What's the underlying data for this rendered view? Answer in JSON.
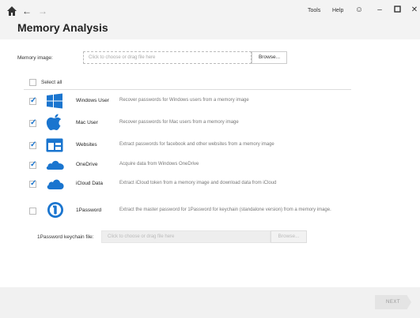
{
  "header": {
    "menu": {
      "tools": "Tools",
      "help": "Help"
    },
    "title": "Memory Analysis"
  },
  "memory_image": {
    "label": "Memory image:",
    "placeholder": "Click to choose or drag file here",
    "browse": "Browse..."
  },
  "select_all": {
    "label": "Select all",
    "checked": false
  },
  "rows": [
    {
      "name": "Windows User",
      "desc": "Recover passwords for Windows users from a memory image",
      "checked": true,
      "icon": "windows-icon"
    },
    {
      "name": "Mac User",
      "desc": "Recover passwords for Mac users from a memory image",
      "checked": true,
      "icon": "apple-icon"
    },
    {
      "name": "Websites",
      "desc": "Extract passwords for facebook and other websites from a memory image",
      "checked": true,
      "icon": "browser-window-icon"
    },
    {
      "name": "OneDrive",
      "desc": "Acquire data from Windows OneDrive",
      "checked": true,
      "icon": "onedrive-cloud-icon"
    },
    {
      "name": "iCloud Data",
      "desc": "Extract iCloud token from a memory image and download data from iCloud",
      "checked": true,
      "icon": "icloud-icon"
    },
    {
      "name": "1Password",
      "desc": "Extract the master password for 1Password for keychain (standalone version) from a memory image.",
      "checked": false,
      "icon": "1password-icon"
    }
  ],
  "keychain": {
    "label": "1Password keychain file:",
    "placeholder": "Click to choose or drag file here",
    "browse": "Browse..."
  },
  "footer": {
    "next": "NEXT"
  },
  "colors": {
    "accent": "#1a75cf",
    "header_bg": "#f3f3f3",
    "footer_bg": "#f1f1f1"
  }
}
